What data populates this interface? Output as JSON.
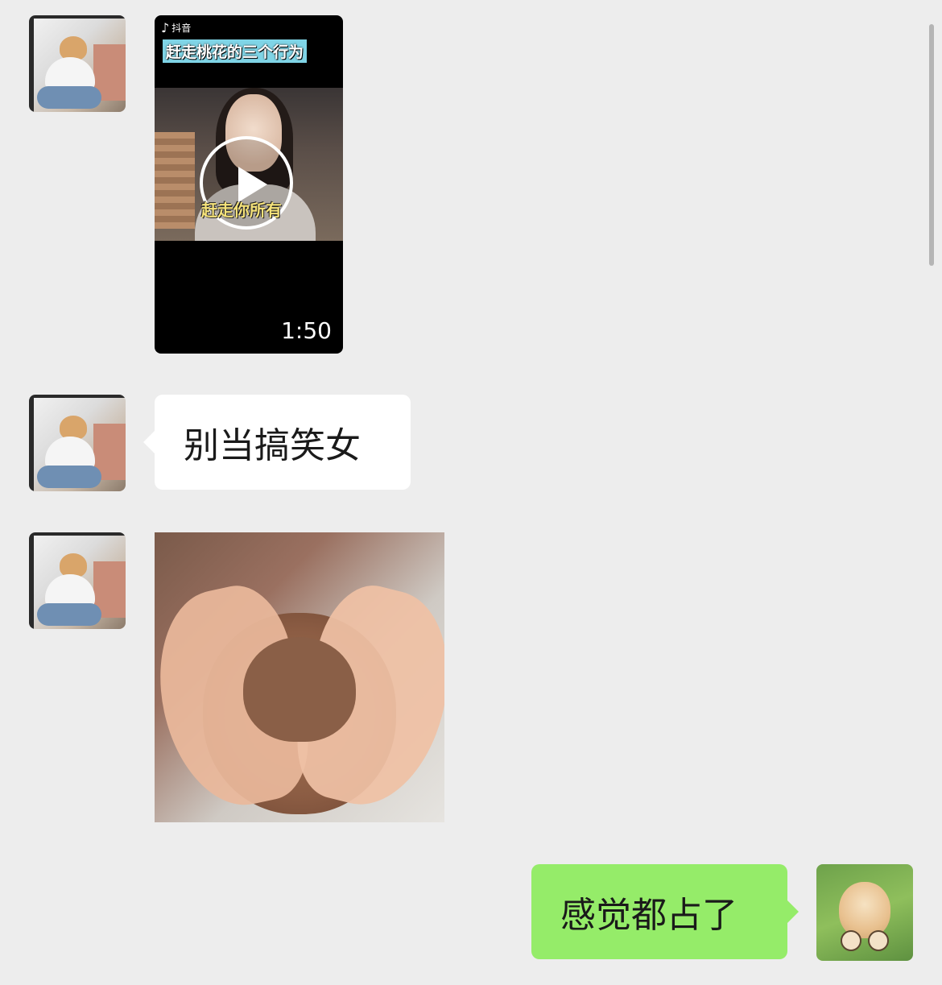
{
  "messages": [
    {
      "type": "video",
      "sender": "contact",
      "platform_label": "抖音",
      "platform_icon": "tiktok-icon",
      "title": "赶走桃花的三个行为",
      "subtitle": "赶走你所有",
      "duration": "1:50"
    },
    {
      "type": "text",
      "sender": "contact",
      "text": "别当搞笑女"
    },
    {
      "type": "image",
      "sender": "contact",
      "description": "hands-heart-over-kitten"
    },
    {
      "type": "text",
      "sender": "me",
      "text": "感觉都占了"
    }
  ],
  "colors": {
    "background": "#ededed",
    "incoming_bubble": "#ffffff",
    "outgoing_bubble": "#95ec69"
  }
}
